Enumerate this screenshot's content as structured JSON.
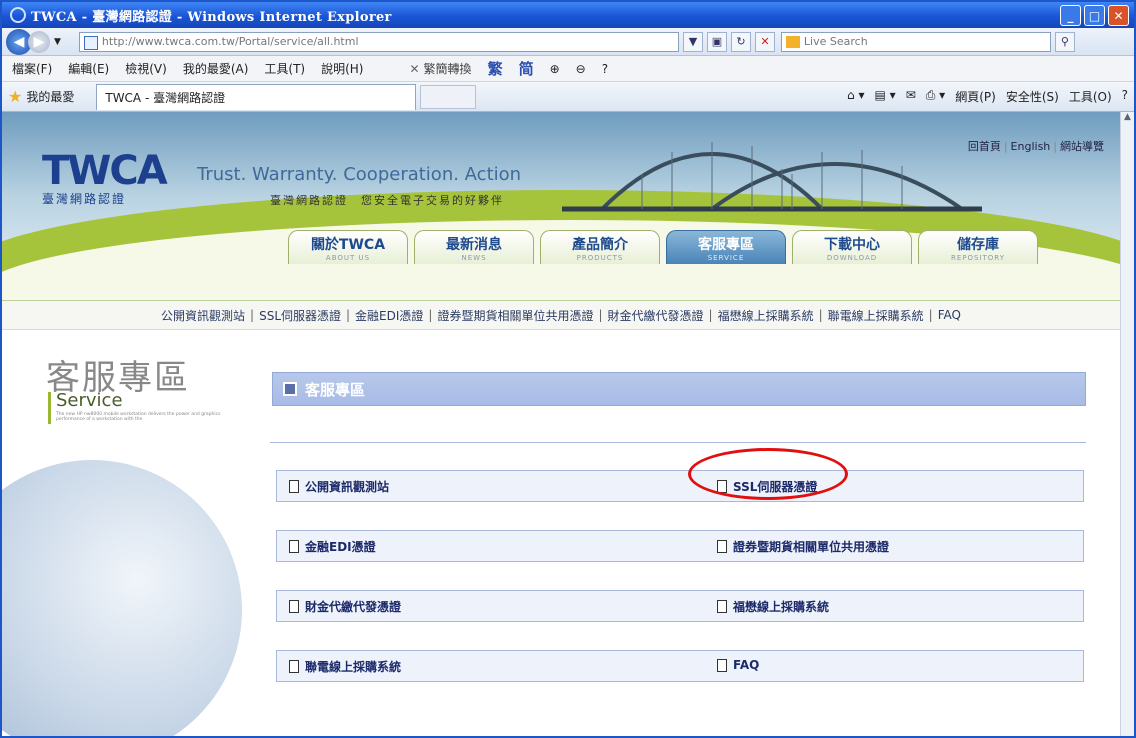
{
  "window": {
    "title": "TWCA - 臺灣網路認證 - Windows Internet Explorer"
  },
  "addressbar": {
    "url": "http://www.twca.com.tw/Portal/service/all.html",
    "search_placeholder": "Live Search"
  },
  "menubar": {
    "items": [
      "檔案(F)",
      "編輯(E)",
      "檢視(V)",
      "我的最愛(A)",
      "工具(T)",
      "說明(H)"
    ],
    "convert": "繁簡轉換",
    "trad": "繁",
    "simp": "简"
  },
  "favbar": {
    "favorites": "我的最愛",
    "tab_title": "TWCA - 臺灣網路認證",
    "page_menu": "網頁(P)",
    "safety_menu": "安全性(S)",
    "tools_menu": "工具(O)"
  },
  "header": {
    "logo_text": "TWCA",
    "logo_sub": "臺灣網路認證",
    "slogan": "Trust. Warranty. Cooperation. Action",
    "slogan_cn": "臺灣網路認證　您安全電子交易的好夥伴",
    "toplinks": [
      "回首頁",
      "English",
      "網站導覽"
    ],
    "tabs": [
      {
        "cn": "關於TWCA",
        "en": "ABOUT US"
      },
      {
        "cn": "最新消息",
        "en": "NEWS"
      },
      {
        "cn": "產品簡介",
        "en": "PRODUCTS"
      },
      {
        "cn": "客服專區",
        "en": "SERVICE"
      },
      {
        "cn": "下載中心",
        "en": "DOWNLOAD"
      },
      {
        "cn": "儲存庫",
        "en": "REPOSITORY"
      }
    ]
  },
  "subnav": [
    "公開資訊觀測站",
    "SSL伺服器憑證",
    "金融EDI憑證",
    "證券暨期貨相關單位共用憑證",
    "財金代繳代發憑證",
    "福懋線上採購系統",
    "聯電線上採購系統",
    "FAQ"
  ],
  "side": {
    "title_cn": "客服專區",
    "title_en": "Service",
    "blurb": "The new HP nw8000 mobile workstation delivers the power and graphics performance of a workstation with the"
  },
  "main": {
    "heading": "客服專區",
    "links": [
      [
        "公開資訊觀測站",
        "SSL伺服器憑證"
      ],
      [
        "金融EDI憑證",
        "證券暨期貨相關單位共用憑證"
      ],
      [
        "財金代繳代發憑證",
        "福懋線上採購系統"
      ],
      [
        "聯電線上採購系統",
        "FAQ"
      ]
    ]
  },
  "colors": {
    "highlight_circle": "#e01010",
    "title_bar": "#1a55d6"
  }
}
